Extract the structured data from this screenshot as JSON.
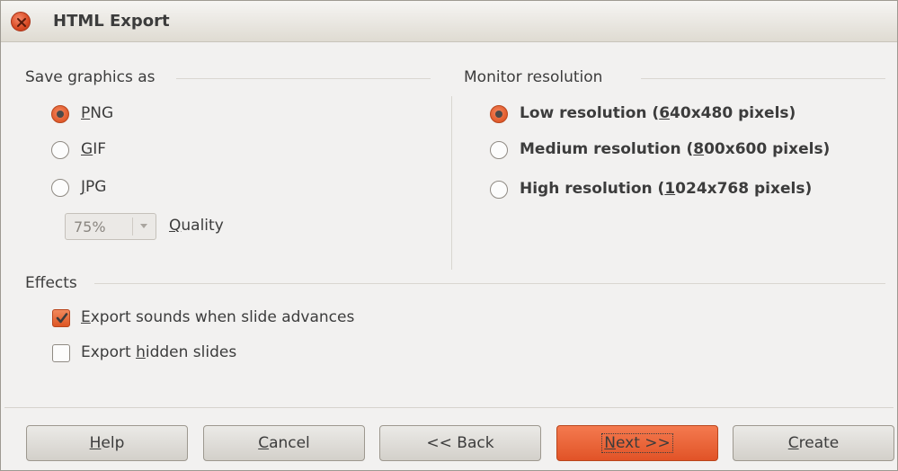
{
  "window": {
    "title": "HTML Export"
  },
  "graphics": {
    "group_label": "Save graphics as",
    "options": [
      {
        "label": "PNG",
        "mnemonic": "P",
        "rest": "NG",
        "checked": true
      },
      {
        "label": "GIF",
        "mnemonic": "G",
        "rest": "IF",
        "checked": false
      },
      {
        "label": "JPG",
        "mnemonic": "J",
        "rest": "PG",
        "checked": false
      }
    ],
    "quality": {
      "value": "75%",
      "label": "Quality",
      "mnemonic": "Q",
      "rest": "uality"
    }
  },
  "resolution": {
    "group_label": "Monitor resolution",
    "options": [
      {
        "label": "Low resolution (640x480 pixels)",
        "before": "Low resolution (",
        "mnemonic": "6",
        "after": "40x480 pixels)",
        "checked": true
      },
      {
        "label": "Medium resolution (800x600 pixels)",
        "before": "Medium resolution (",
        "mnemonic": "8",
        "after": "00x600 pixels)",
        "checked": false
      },
      {
        "label": "High resolution (1024x768 pixels)",
        "before": "High resolution (",
        "mnemonic": "1",
        "after": "024x768 pixels)",
        "checked": false
      }
    ]
  },
  "effects": {
    "group_label": "Effects",
    "items": [
      {
        "label": "Export sounds when slide advances",
        "before": "",
        "mnemonic": "E",
        "after": "xport sounds when slide advances",
        "checked": true
      },
      {
        "label": "Export hidden slides",
        "before": "Export ",
        "mnemonic": "h",
        "after": "idden slides",
        "checked": false
      }
    ]
  },
  "buttons": [
    {
      "label": "Help",
      "mnemonic": "H",
      "rest": "elp"
    },
    {
      "label": "Cancel",
      "mnemonic": "C",
      "rest": "ancel"
    },
    {
      "label": "<< Back",
      "mnemonic": "",
      "rest": "<< Back"
    },
    {
      "label": "Next >>",
      "mnemonic": "N",
      "rest": "ext >>"
    },
    {
      "label": "Create",
      "mnemonic": "C",
      "rest": "reate"
    }
  ],
  "colors": {
    "accent": "#e05a2b",
    "background": "#f2f1f0"
  },
  "icons": {
    "close": "close-icon",
    "dropdown": "chevron-down-icon",
    "check": "check-icon"
  }
}
